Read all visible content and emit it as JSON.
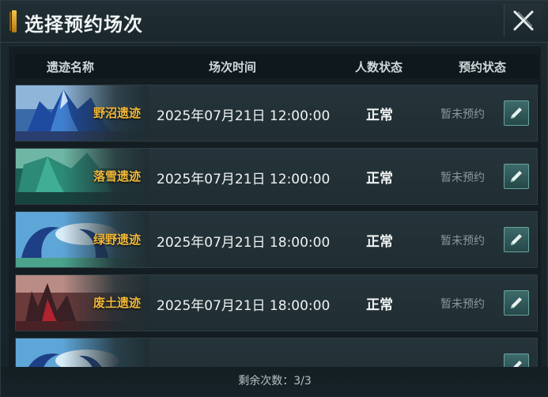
{
  "title": "选择预约场次",
  "header": {
    "col_name": "遗迹名称",
    "col_time": "场次时间",
    "col_people": "人数状态",
    "col_reservation": "预约状态"
  },
  "rows": [
    {
      "name": "野沼遗迹",
      "time": "2025年07月21日 12:00:00",
      "status": "正常",
      "reservation": "暂未预约",
      "theme": "blue-crystal"
    },
    {
      "name": "落雪遗迹",
      "time": "2025年07月21日 12:00:00",
      "status": "正常",
      "reservation": "暂未预约",
      "theme": "teal-cliff"
    },
    {
      "name": "绿野遗迹",
      "time": "2025年07月21日 18:00:00",
      "status": "正常",
      "reservation": "暂未预约",
      "theme": "sky-wave"
    },
    {
      "name": "废土遗迹",
      "time": "2025年07月21日 18:00:00",
      "status": "正常",
      "reservation": "暂未预约",
      "theme": "red-ruins"
    },
    {
      "name": "",
      "time": "",
      "status": "",
      "reservation": "",
      "theme": "sky-wave"
    }
  ],
  "footer": {
    "remaining": "剩余次数：3/3"
  },
  "icons": {
    "close": "close-icon",
    "edit": "pencil-icon"
  },
  "colors": {
    "accent_gold": "#f0b83a",
    "edit_button": "#3d6a6a",
    "muted_text": "#8b989c"
  }
}
